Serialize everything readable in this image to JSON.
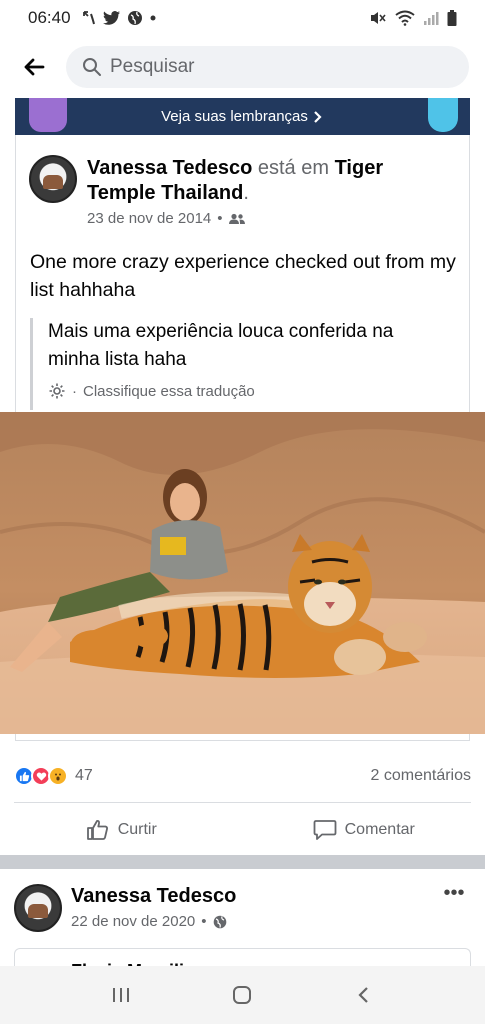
{
  "status_bar": {
    "time": "06:40",
    "left_icons": [
      "missed-call-icon",
      "twitter-icon",
      "globe-icon",
      "dot-icon"
    ],
    "right_icons": [
      "mute-icon",
      "wifi-icon",
      "signal-icon",
      "battery-icon"
    ]
  },
  "header": {
    "search_placeholder": "Pesquisar"
  },
  "memory_banner": {
    "label": "Veja suas lembranças"
  },
  "memory_post": {
    "author": "Vanessa Tedesco",
    "verb": "está em",
    "place": "Tiger Temple Thailand",
    "period": ".",
    "date": "23 de nov de 2014",
    "separator": " • ",
    "audience_icon": "friends-icon",
    "text": "One more crazy experience checked out from my list hahhaha",
    "translation": "Mais uma experiência louca conferida na minha lista haha",
    "rate_translation": "Classifique essa tradução",
    "rate_bullet": "·"
  },
  "reactions": {
    "types": [
      "like",
      "love",
      "wow"
    ],
    "count": "47",
    "comments": "2 comentários"
  },
  "actions": {
    "like": "Curtir",
    "comment": "Comentar"
  },
  "next_post": {
    "author": "Vanessa Tedesco",
    "date": "22 de nov de 2020",
    "separator": " • ",
    "audience_icon": "public-globe-icon",
    "more": "•••",
    "shared_author": "Flavia Marcilio"
  },
  "colors": {
    "brand_blue": "#1877f2",
    "banner_bg": "#22395e",
    "love": "#f33e58",
    "wow": "#f7b125",
    "muted_text": "#65676b"
  }
}
